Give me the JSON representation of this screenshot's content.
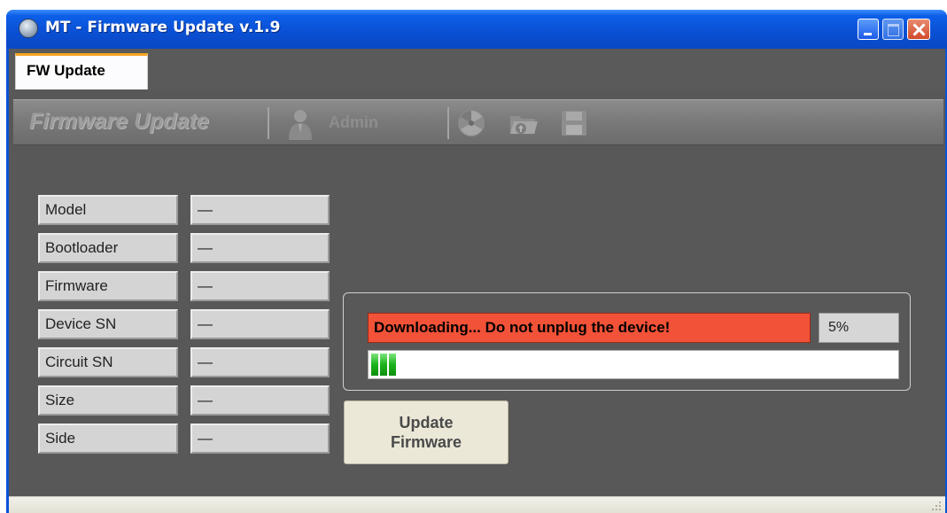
{
  "window": {
    "title": "MT - Firmware Update v.1.9"
  },
  "tabs": [
    {
      "label": "FW Update",
      "active": true
    }
  ],
  "toolbar": {
    "title": "Firmware Update",
    "admin_label": "Admin",
    "icons": [
      "admin-person-icon",
      "radiation-icon",
      "open-folder-icon",
      "save-disk-icon"
    ]
  },
  "info": {
    "rows": [
      {
        "label": "Model",
        "value": "—"
      },
      {
        "label": "Bootloader",
        "value": "—"
      },
      {
        "label": "Firmware",
        "value": "—"
      },
      {
        "label": "Device SN",
        "value": "—"
      },
      {
        "label": "Circuit SN",
        "value": "—"
      },
      {
        "label": "Size",
        "value": "—"
      },
      {
        "label": "Side",
        "value": "—"
      }
    ]
  },
  "progress": {
    "status_text": "Downloading... Do not unplug the device!",
    "percent_text": "5%",
    "value": 0.05,
    "status_color": "#f25237",
    "bar_color": "#1bb31b"
  },
  "actions": {
    "update_line1": "Update",
    "update_line2": "Firmware"
  }
}
